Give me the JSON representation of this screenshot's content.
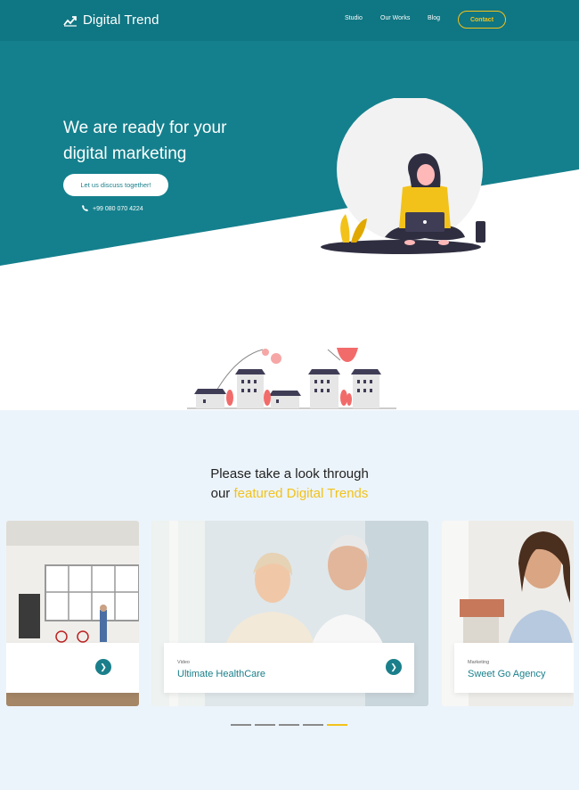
{
  "nav": {
    "brand": "Digital Trend",
    "links": [
      "Studio",
      "Our Works",
      "Blog"
    ],
    "contact": "Contact"
  },
  "hero": {
    "title_line1": "We are ready for your",
    "title_line2": "digital marketing",
    "cta": "Let us discuss together!",
    "phone": "+99 080 070 4224"
  },
  "featured": {
    "title_line1": "Please take a look through",
    "title_prefix": "our",
    "title_highlight": "featured Digital Trends",
    "cards": [
      {
        "category": "",
        "name": ""
      },
      {
        "category": "Video",
        "name": "Ultimate HealthCare"
      },
      {
        "category": "Marketing",
        "name": "Sweet Go Agency"
      }
    ],
    "slider_dots": 5,
    "active_dot": 4
  },
  "colors": {
    "primary": "#1a7f8a",
    "accent": "#f2c21b",
    "section_bg": "#ecf4fb"
  },
  "icons": {
    "logo": "trend-line-icon",
    "phone": "phone-icon",
    "arrow": "chevron-right-icon"
  }
}
